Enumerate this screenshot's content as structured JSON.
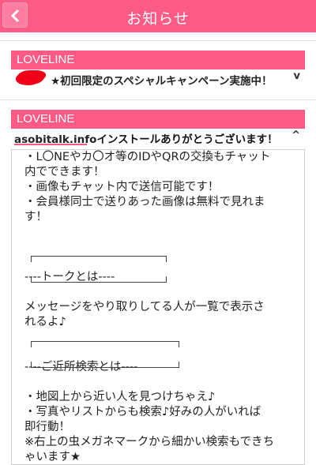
{
  "header": {
    "title": "お知らせ"
  },
  "notices": [
    {
      "source": "LOVELINE",
      "text": "★初回限定のスペシャルキャンペーン実施中！",
      "toggle": "v"
    },
    {
      "source": "LOVELINE",
      "domain": "asobitalk.info",
      "text": "インストールありがとうございます！",
      "toggle": "^"
    }
  ],
  "body": {
    "lines": [
      "・L〇NEやカ〇オ等のIDやQRの交換もチャット",
      "内でできます！",
      "・画像もチャット内で送信可能です！",
      "・会員様同士で送りあった画像は無料で見れま",
      "す！",
      "",
      "",
      "",
      "----トークとは----",
      "",
      "メッセージをやり取りしてる人が一覧で表示さ",
      "れるよ♪",
      "",
      "",
      "----ご近所検索とは----",
      "",
      "・地図上から近い人を見つけちゃえ♪",
      "・写真やリストからも検索♪好みの人がいれば",
      "即行動！",
      "※右上の虫メガネマークから細かい検索もできち",
      "ゃいます★"
    ]
  },
  "colors": {
    "accent": "#fe5a86",
    "redact": "#f00018"
  }
}
